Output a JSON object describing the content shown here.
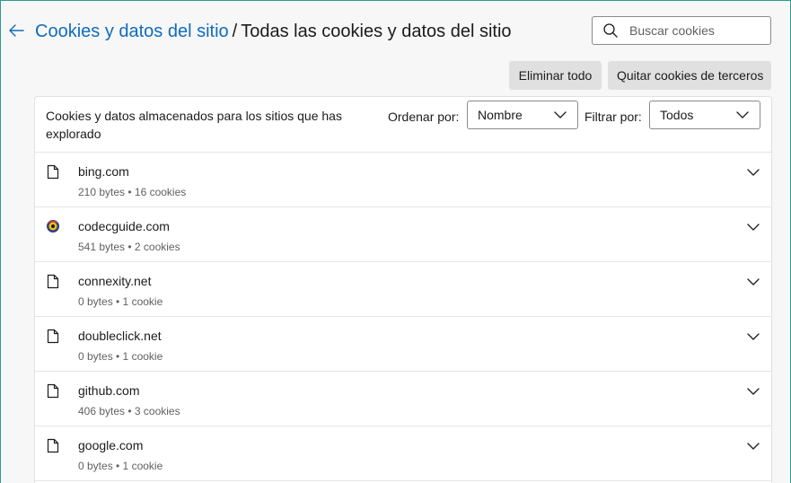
{
  "header": {
    "breadcrumb_parent": "Cookies y datos del sitio",
    "breadcrumb_separator": "/",
    "breadcrumb_current": "Todas las cookies y datos del sitio"
  },
  "search": {
    "placeholder": "Buscar cookies",
    "value": ""
  },
  "actions": {
    "delete_all_label": "Eliminar todo",
    "remove_third_party_label": "Quitar cookies de terceros"
  },
  "list": {
    "description": "Cookies y datos almacenados para los sitios que has explorado",
    "sort_label": "Ordenar por:",
    "sort_value": "Nombre",
    "filter_label": "Filtrar por:",
    "filter_value": "Todos"
  },
  "sites": [
    {
      "name": "bing.com",
      "meta": "210 bytes • 16 cookies",
      "icon": "file-icon"
    },
    {
      "name": "codecguide.com",
      "meta": "541 bytes • 2 cookies",
      "icon": "favicon-codecguide"
    },
    {
      "name": "connexity.net",
      "meta": "0 bytes • 1 cookie",
      "icon": "file-icon"
    },
    {
      "name": "doubleclick.net",
      "meta": "0 bytes • 1 cookie",
      "icon": "file-icon"
    },
    {
      "name": "github.com",
      "meta": "406 bytes • 3 cookies",
      "icon": "file-icon"
    },
    {
      "name": "google.com",
      "meta": "0 bytes • 1 cookie",
      "icon": "file-icon"
    }
  ],
  "colors": {
    "link": "#0f6cbd",
    "frame_border": "#2a9d8f",
    "button_bg": "#e0e0e0"
  }
}
